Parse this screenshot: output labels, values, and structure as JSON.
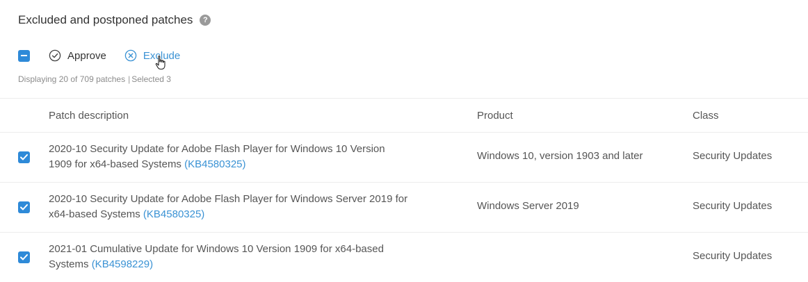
{
  "header": {
    "title": "Excluded and postponed patches",
    "help_glyph": "?"
  },
  "toolbar": {
    "approve_label": "Approve",
    "exclude_label": "Exclude"
  },
  "status": {
    "displaying": "Displaying 20 of 709 patches",
    "separator": "|",
    "selected": "Selected 3"
  },
  "table": {
    "columns": {
      "description": "Patch description",
      "product": "Product",
      "class": "Class"
    },
    "rows": [
      {
        "checked": true,
        "description": "2020-10 Security Update for Adobe Flash Player for Windows 10 Version 1909 for x64-based Systems",
        "kb": "(KB4580325)",
        "product": "Windows 10, version 1903 and later",
        "class": "Security Updates"
      },
      {
        "checked": true,
        "description": "2020-10 Security Update for Adobe Flash Player for Windows Server 2019 for x64-based Systems",
        "kb": "(KB4580325)",
        "product": "Windows Server 2019",
        "class": "Security Updates"
      },
      {
        "checked": true,
        "description": "2021-01 Cumulative Update for Windows 10 Version 1909 for x64-based Systems",
        "kb": "(KB4598229)",
        "product": "",
        "class": "Security Updates"
      }
    ]
  },
  "colors": {
    "accent": "#2e8ad8",
    "link": "#3a92d4",
    "muted_text": "#8c8c8c",
    "border": "#ececec"
  },
  "icons": {
    "help": "help-icon",
    "approve": "check-circle-icon",
    "exclude": "x-circle-icon",
    "cursor": "hand-pointer-icon"
  }
}
